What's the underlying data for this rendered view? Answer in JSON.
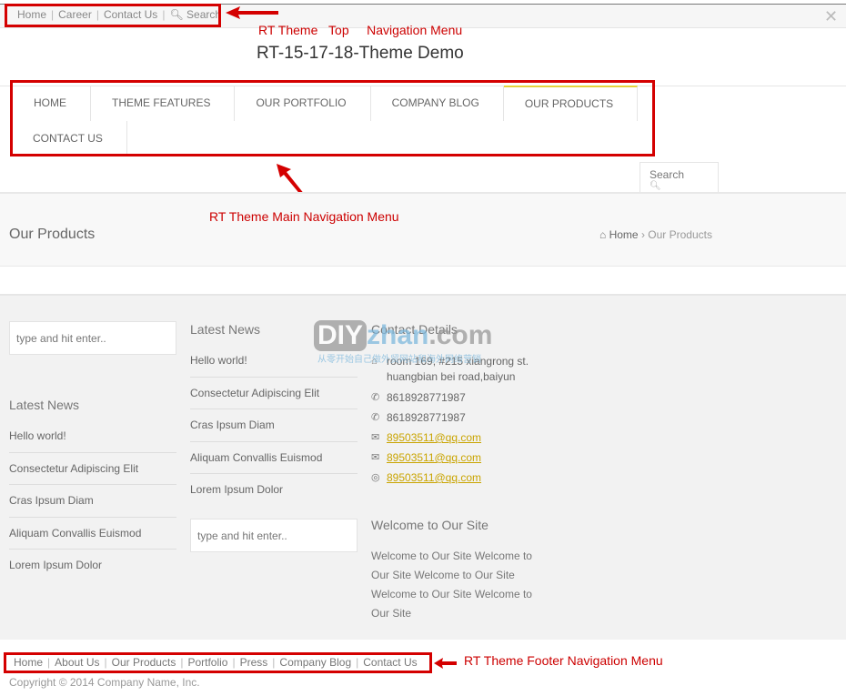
{
  "top_nav": {
    "items": [
      "Home",
      "Career",
      "Contact Us"
    ],
    "search": "Search"
  },
  "annotations": {
    "top": [
      "RT Theme",
      "Top",
      "Navigation Menu"
    ],
    "main": "RT Theme Main Navigation Menu",
    "footer": "RT Theme Footer Navigation Menu"
  },
  "site_title": "RT-15-17-18-Theme Demo",
  "main_nav": {
    "items": [
      "HOME",
      "THEME FEATURES",
      "OUR PORTFOLIO",
      "COMPANY BLOG",
      "OUR PRODUCTS",
      "CONTACT US"
    ],
    "active": "OUR PRODUCTS",
    "active_color": "#e5d23b"
  },
  "search_box": {
    "placeholder": "Search"
  },
  "page": {
    "title": "Our Products",
    "breadcrumb": {
      "home": "Home",
      "current": "Our Products"
    }
  },
  "widgets": {
    "search_placeholder": "type and hit enter..",
    "latest_news_title": "Latest News",
    "news": [
      "Hello world!",
      "Consectetur Adipiscing Elit",
      "Cras Ipsum Diam",
      "Aliquam Convallis Euismod",
      "Lorem Ipsum Dolor"
    ],
    "contact": {
      "title": "Contact Details",
      "address": [
        "room 169, #215 xiangrong st.",
        "huangbian bei road,baiyun"
      ],
      "phones": [
        "8618928771987",
        "8618928771987"
      ],
      "emails": [
        "89503511@qq.com",
        "89503511@qq.com",
        "89503511@qq.com"
      ],
      "link_color": "#c9a400"
    },
    "welcome": {
      "title": "Welcome to Our Site",
      "lines": [
        "Welcome to Our Site Welcome to",
        "Our Site Welcome to Our Site",
        "Welcome to Our Site Welcome to",
        "Our Site"
      ]
    }
  },
  "watermark": {
    "logo": "DIYzhan.com",
    "tagline": "从零开始自己做外贸网站和海外网络营销"
  },
  "footer": {
    "nav": [
      "Home",
      "About Us",
      "Our Products",
      "Portfolio",
      "Press",
      "Company Blog",
      "Contact Us"
    ],
    "copyright": "Copyright © 2014 Company Name, Inc."
  },
  "accent_red": "#d40000"
}
